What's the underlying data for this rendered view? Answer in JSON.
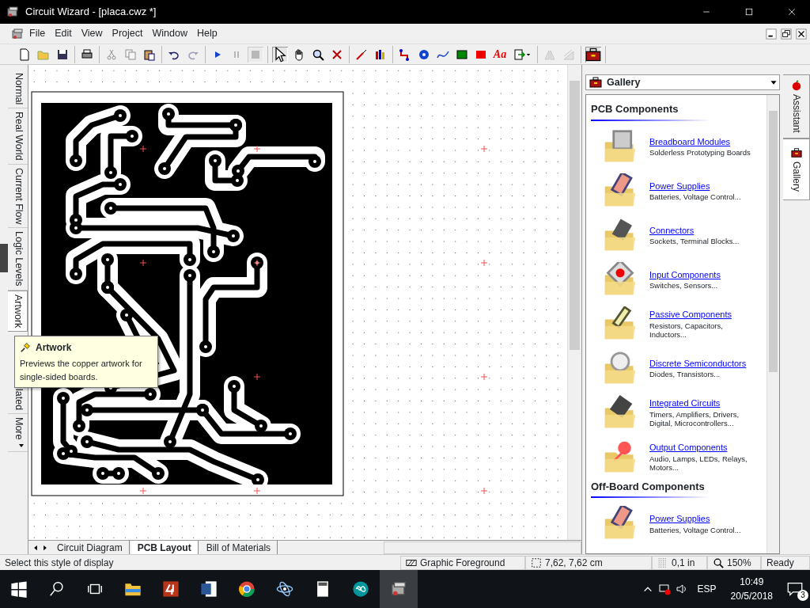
{
  "window": {
    "title": "Circuit Wizard - [placa.cwz *]"
  },
  "menu": [
    "File",
    "Edit",
    "View",
    "Project",
    "Window",
    "Help"
  ],
  "toolbar": [
    [
      {
        "disabled": false
      },
      {
        "disabled": false
      },
      {
        "disabled": false
      }
    ],
    [
      {
        "disabled": false
      }
    ],
    [
      {
        "disabled": true
      },
      {
        "disabled": true
      },
      {
        "disabled": false
      }
    ],
    [
      {
        "disabled": false
      },
      {
        "disabled": true
      }
    ],
    [
      {
        "disabled": false
      },
      {
        "disabled": true
      },
      {
        "disabled": true,
        "pressed": true
      }
    ],
    [
      {
        "disabled": false,
        "pressed": true
      },
      {
        "disabled": false
      },
      {
        "disabled": false
      },
      {
        "disabled": false
      }
    ],
    [
      {
        "disabled": false
      },
      {
        "disabled": false
      }
    ],
    [
      {
        "disabled": false
      },
      {
        "disabled": false
      },
      {
        "disabled": false
      },
      {
        "disabled": false
      },
      {
        "disabled": false
      },
      {
        "disabled": false,
        "label": "Aa"
      },
      {
        "disabled": false
      }
    ],
    [
      {
        "disabled": true
      },
      {
        "disabled": true
      }
    ],
    [
      {
        "disabled": false,
        "pressed": true
      }
    ]
  ],
  "view_tabs": [
    {
      "label": "Normal",
      "selected": false
    },
    {
      "label": "Real World",
      "selected": false
    },
    {
      "label": "Current Flow",
      "selected": false
    },
    {
      "label": "Logic Levels",
      "selected": false
    },
    {
      "label": "Artwork",
      "selected": true
    },
    {
      "label": "lated",
      "selected": false
    },
    {
      "label": "More",
      "selected": false
    }
  ],
  "tooltip": {
    "title": "Artwork",
    "text": "Previews the copper artwork for single-sided boards."
  },
  "document_tabs": [
    {
      "label": "Circuit Diagram",
      "selected": false
    },
    {
      "label": "PCB Layout",
      "selected": true
    },
    {
      "label": "Bill of Materials",
      "selected": false
    }
  ],
  "gallery": {
    "selector": "Gallery",
    "sections": [
      {
        "title": "PCB Components",
        "items": [
          {
            "title": "Breadboard Modules",
            "description": "Solderless Prototyping Boards"
          },
          {
            "title": "Power Supplies",
            "description": "Batteries, Voltage Control..."
          },
          {
            "title": "Connectors",
            "description": "Sockets, Terminal Blocks..."
          },
          {
            "title": "Input Components",
            "description": "Switches, Sensors..."
          },
          {
            "title": "Passive Components",
            "description": "Resistors, Capacitors, Inductors..."
          },
          {
            "title": "Discrete Semiconductors",
            "description": "Diodes, Transistors..."
          },
          {
            "title": "Integrated Circuits",
            "description": "Timers, Amplifiers, Drivers, Digital, Microcontrollers..."
          },
          {
            "title": "Output Components",
            "description": "Audio, Lamps, LEDs, Relays, Motors..."
          }
        ]
      },
      {
        "title": "Off-Board Components",
        "items": [
          {
            "title": "Power Supplies",
            "description": "Batteries, Voltage Control..."
          }
        ]
      }
    ]
  },
  "side_tabs": [
    {
      "label": "Assistant",
      "selected": false
    },
    {
      "label": "Gallery",
      "selected": true
    }
  ],
  "status_bar": {
    "message": "Select this style of display",
    "layer": "Graphic Foreground",
    "position": "7,62, 7,62 cm",
    "grid": "0,1 in",
    "zoom": "150%",
    "state": "Ready"
  },
  "taskbar": {
    "language": "ESP",
    "time": "10:49",
    "date": "20/5/2018",
    "notifications": "3"
  }
}
